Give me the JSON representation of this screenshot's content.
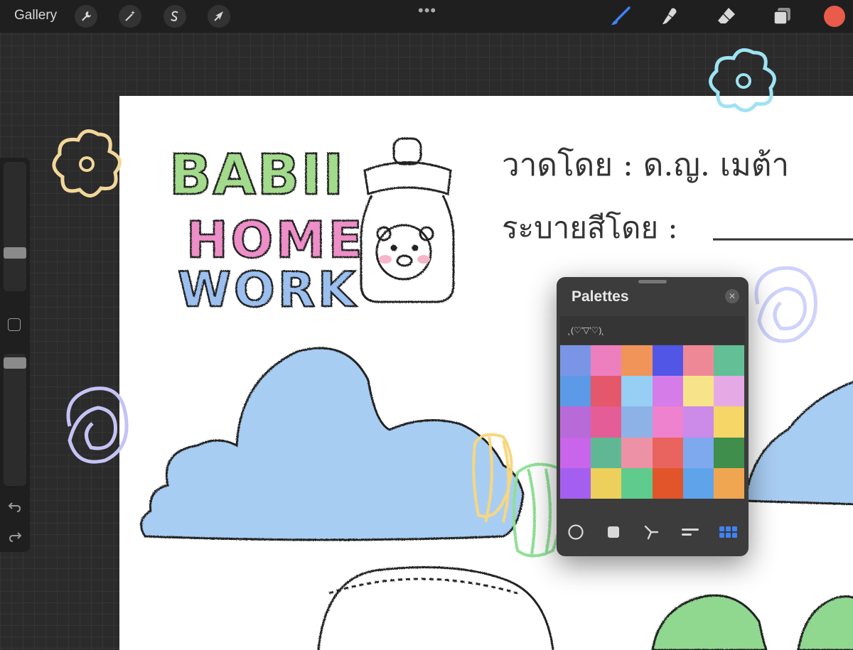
{
  "topbar": {
    "gallery_label": "Gallery",
    "actions": [
      {
        "name": "wrench-icon"
      },
      {
        "name": "magic-wand-icon"
      },
      {
        "name": "selection-s-icon"
      },
      {
        "name": "transform-arrow-icon"
      }
    ],
    "more_label": "•••",
    "tools": [
      {
        "name": "brush-icon",
        "active": true,
        "color": "#3f82f7"
      },
      {
        "name": "smudge-icon",
        "active": false
      },
      {
        "name": "eraser-icon",
        "active": false
      },
      {
        "name": "layers-icon",
        "active": false
      }
    ],
    "current_color": "#e95b4a"
  },
  "sidebar": {
    "brush_size_label": "",
    "opacity_label": "",
    "undo_icon": "undo-icon",
    "redo_icon": "redo-icon"
  },
  "artwork": {
    "title_line1": "BABII",
    "title_line2": "HOME",
    "title_line3": "WORK",
    "drawn_by": "วาดโดย : ด.ญ. เมต้า",
    "colored_by": "ระบายสีโดย :"
  },
  "palettes": {
    "title": "Palettes",
    "palette_name": "˛(♡'▽'♡)˛",
    "swatches": [
      "#7a95e6",
      "#ee7fbf",
      "#f0945a",
      "#5156e6",
      "#ef8896",
      "#63bf95",
      "#5c9ae8",
      "#e5576a",
      "#97cff4",
      "#d57ce8",
      "#f7e48a",
      "#e5aae6",
      "#b86ad9",
      "#e45d96",
      "#8db2e7",
      "#ee82cf",
      "#cc8ae9",
      "#f5d666",
      "#c865ea",
      "#5fb893",
      "#ec91a6",
      "#ea645f",
      "#7fa9ef",
      "#3f8e4b",
      "#a55ff0",
      "#ecd05b",
      "#5fcb8c",
      "#e2542a",
      "#5fa3ea",
      "#f0a651"
    ],
    "tabs": [
      {
        "name": "disc-view-tab-icon"
      },
      {
        "name": "classic-view-tab-icon"
      },
      {
        "name": "harmony-view-tab-icon"
      },
      {
        "name": "value-view-tab-icon"
      },
      {
        "name": "palettes-grid-tab-icon",
        "active": true
      }
    ]
  }
}
